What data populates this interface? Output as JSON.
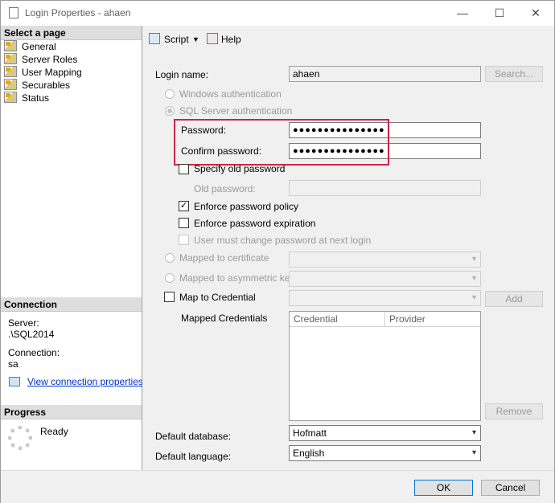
{
  "window": {
    "title": "Login Properties -  ahaen",
    "minimize": "—",
    "maximize": "☐",
    "close": "✕"
  },
  "select_page": {
    "header": "Select a page",
    "items": [
      {
        "label": "General"
      },
      {
        "label": "Server Roles"
      },
      {
        "label": "User Mapping"
      },
      {
        "label": "Securables"
      },
      {
        "label": "Status"
      }
    ]
  },
  "connection": {
    "header": "Connection",
    "server_label": "Server:",
    "server_value": ".\\SQL2014",
    "connection_label": "Connection:",
    "connection_value": "sa",
    "view_link": "View connection properties"
  },
  "progress": {
    "header": "Progress",
    "status": "Ready"
  },
  "toolbar": {
    "script_label": "Script",
    "help_label": "Help"
  },
  "form": {
    "login_name_label": "Login name:",
    "login_name_value": "ahaen",
    "search_button": "Search...",
    "windows_auth": "Windows authentication",
    "sql_auth": "SQL Server authentication",
    "password_label": "Password:",
    "password_value": "●●●●●●●●●●●●●●●",
    "confirm_label": "Confirm password:",
    "confirm_value": "●●●●●●●●●●●●●●●",
    "specify_old": "Specify old password",
    "old_password_label": "Old password:",
    "enforce_policy": "Enforce password policy",
    "enforce_expiration": "Enforce password expiration",
    "must_change": "User must change password at next login",
    "mapped_cert": "Mapped to certificate",
    "mapped_asym": "Mapped to asymmetric key",
    "map_credential": "Map to Credential",
    "add_button": "Add",
    "mapped_credentials_label": "Mapped Credentials",
    "grid_columns": [
      "Credential",
      "Provider"
    ],
    "remove_button": "Remove",
    "default_db_label": "Default database:",
    "default_db_value": "Hofmatt",
    "default_lang_label": "Default language:",
    "default_lang_value": "English",
    "check_mark": "✓"
  },
  "footer": {
    "ok": "OK",
    "cancel": "Cancel"
  },
  "colors": {
    "highlight_box": "#c8254a",
    "link": "#0033cc"
  }
}
